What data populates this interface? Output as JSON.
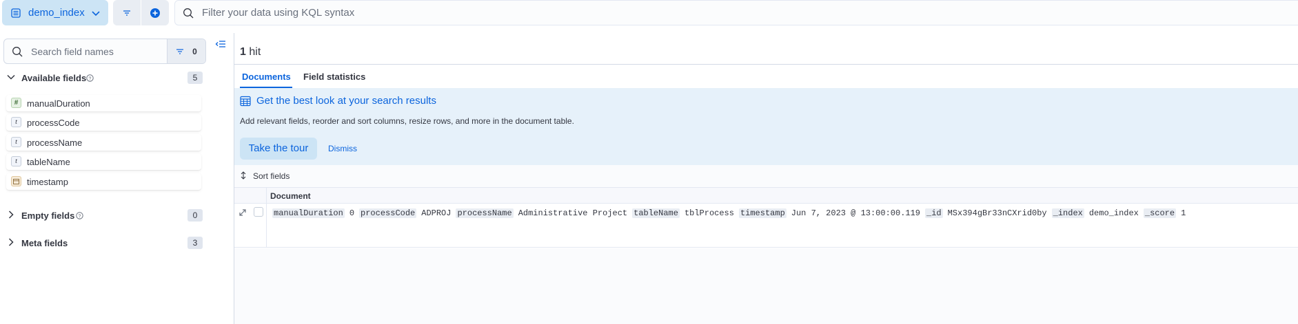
{
  "topbar": {
    "data_view": "demo_index",
    "search_placeholder": "Filter your data using KQL syntax"
  },
  "sidebar": {
    "search_placeholder": "Search field names",
    "filter_count": "0",
    "available": {
      "title": "Available fields",
      "count": "5",
      "fields": [
        {
          "name": "manualDuration",
          "type": "#"
        },
        {
          "name": "processCode",
          "type": "t"
        },
        {
          "name": "processName",
          "type": "t"
        },
        {
          "name": "tableName",
          "type": "t"
        },
        {
          "name": "timestamp",
          "type": "date"
        }
      ]
    },
    "empty": {
      "title": "Empty fields",
      "count": "0"
    },
    "meta": {
      "title": "Meta fields",
      "count": "3"
    }
  },
  "main": {
    "hits_count": "1",
    "hits_label": "hit",
    "tabs": [
      "Documents",
      "Field statistics"
    ],
    "callout": {
      "title": "Get the best look at your search results",
      "description": "Add relevant fields, reorder and sort columns, resize rows, and more in the document table.",
      "tour_button": "Take the tour",
      "dismiss_button": "Dismiss"
    },
    "sort_label": "Sort fields",
    "column_header": "Document",
    "document": [
      {
        "k": "manualDuration",
        "v": "0"
      },
      {
        "k": "processCode",
        "v": "ADPROJ"
      },
      {
        "k": "processName",
        "v": "Administrative Project"
      },
      {
        "k": "tableName",
        "v": "tblProcess"
      },
      {
        "k": "timestamp",
        "v": "Jun 7, 2023 @ 13:00:00.119"
      },
      {
        "k": "_id",
        "v": "MSx394gBr33nCXrid0by"
      },
      {
        "k": "_index",
        "v": "demo_index"
      },
      {
        "k": "_score",
        "v": "1"
      }
    ]
  }
}
